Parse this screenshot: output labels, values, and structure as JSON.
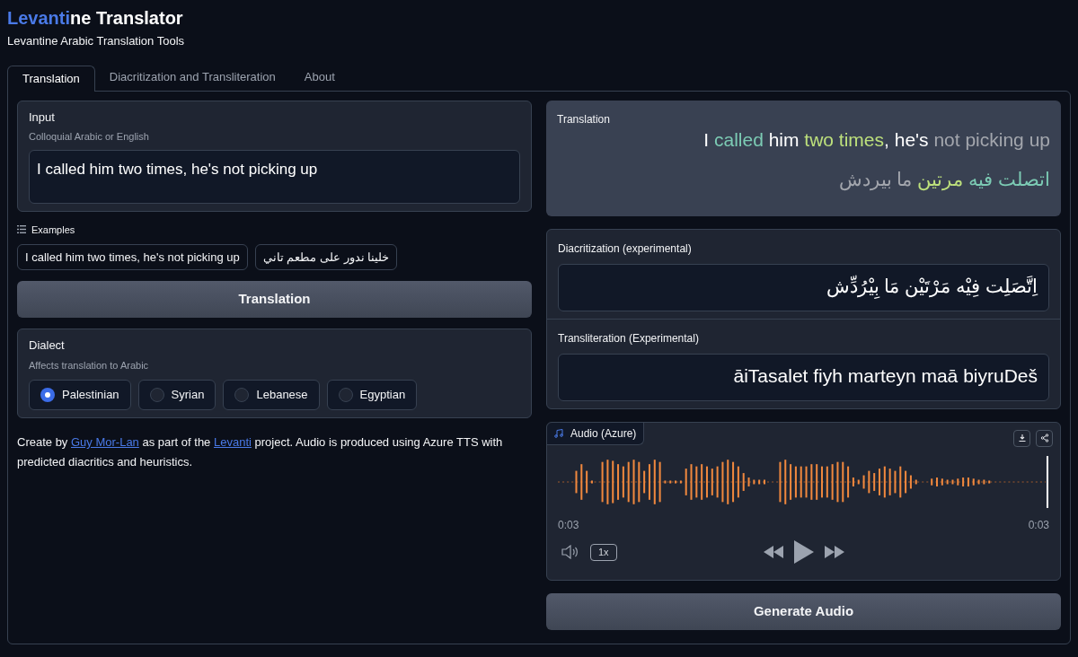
{
  "header": {
    "title": [
      {
        "text": "Levanti",
        "highlight": true
      },
      {
        "text": "ne Translator",
        "highlight": false
      }
    ],
    "subtitle": "Levantine Arabic Translation Tools"
  },
  "tabs": [
    {
      "label": "Translation",
      "selected": true
    },
    {
      "label": "Diacritization and Transliteration",
      "selected": false
    },
    {
      "label": "About",
      "selected": false
    }
  ],
  "input": {
    "label": "Input",
    "hint": "Colloquial Arabic or English",
    "value": "I called him two times, he's not picking up"
  },
  "examples": {
    "label": "Examples",
    "items": [
      "I called him two times, he's not picking up",
      "خلينا ندور على مطعم تاني"
    ]
  },
  "translate_button": "Translation",
  "dialect": {
    "label": "Dialect",
    "hint": "Affects translation to Arabic",
    "options": [
      {
        "label": "Palestinian",
        "selected": true
      },
      {
        "label": "Syrian",
        "selected": false
      },
      {
        "label": "Lebanese",
        "selected": false
      },
      {
        "label": "Egyptian",
        "selected": false
      }
    ]
  },
  "footer": [
    {
      "kind": "text",
      "text": "Create by "
    },
    {
      "kind": "link",
      "text": "Guy Mor-Lan"
    },
    {
      "kind": "text",
      "text": " as part of the "
    },
    {
      "kind": "link",
      "text": "Levanti"
    },
    {
      "kind": "text",
      "text": " project. Audio is produced using Azure TTS with predicted diacritics and heuristics."
    }
  ],
  "translation": {
    "label": "Translation",
    "english": [
      {
        "text": "I ",
        "color": "#ffffff"
      },
      {
        "text": "called",
        "color": "#7ccbb4"
      },
      {
        "text": " him ",
        "color": "#ffffff"
      },
      {
        "text": "two times",
        "color": "#bde07c"
      },
      {
        "text": ", he's ",
        "color": "#ffffff"
      },
      {
        "text": "not picking up",
        "color": "#a3a6ad"
      }
    ],
    "arabic": [
      {
        "text": "اتصلت فيه ",
        "color": "#7ccbb4"
      },
      {
        "text": "مرتين ",
        "color": "#bde07c"
      },
      {
        "text": "ما بيردش",
        "color": "#a3a6ad"
      }
    ]
  },
  "diacritization": {
    "label": "Diacritization (experimental)",
    "value": "اِتَّصَلِت فِيْه مَرْتَيْن مَا بِيْرُدِّش"
  },
  "transliteration": {
    "label": "Transliteration (Experimental)",
    "value": "āiTasalet fiyh marteyn maā biyruDeš"
  },
  "audio": {
    "label": "Audio (Azure)",
    "current": "0:03",
    "duration": "0:03",
    "speed": "1x"
  },
  "generate_button": "Generate Audio"
}
